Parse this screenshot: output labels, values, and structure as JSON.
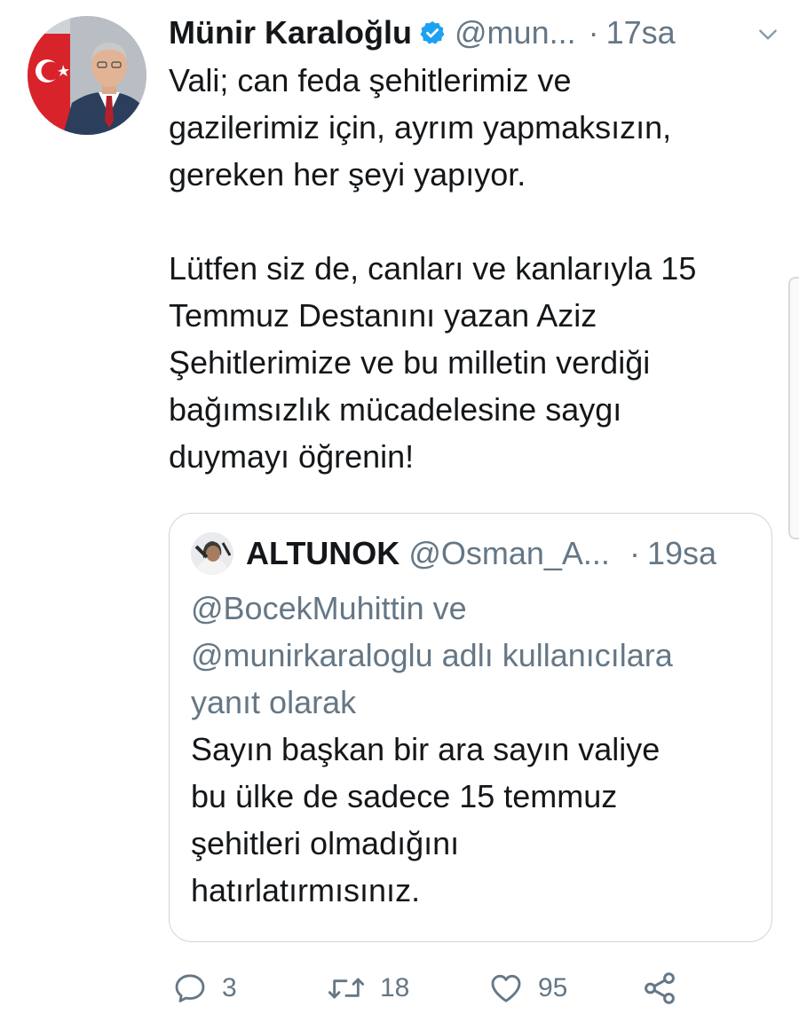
{
  "tweet": {
    "author_name": "Münir Karaloğlu",
    "handle": "@mun...",
    "separator": "·",
    "time": "17sa",
    "text": "Vali; can feda şehitlerimiz ve\ngazilerimiz için, ayrım yapmaksızın,\ngereken her şeyi yapıyor.\n\nLütfen siz de, canları ve kanlarıyla 15\nTemmuz Destanını yazan Aziz\nŞehitlerimize ve bu milletin verdiği\nbağımsızlık mücadelesine saygı\nduymayı öğrenin!"
  },
  "quoted_tweet": {
    "author_name": "ALTUNOK",
    "handle": "@Osman_A...",
    "separator": "·",
    "time": "19sa",
    "replying_to": "@BocekMuhittin ve\n@munirkaraloglu adlı kullanıcılara\nyanıt olarak",
    "text": "Sayın başkan bir ara sayın valiye\nbu ülke de sadece 15 temmuz\nşehitleri olmadığını\nhatırlatırmısınız."
  },
  "actions": {
    "replies": "3",
    "retweets": "18",
    "likes": "95"
  },
  "icons": {
    "verified": "verified-badge-icon",
    "more": "chevron-down-icon",
    "reply": "comment-icon",
    "retweet": "retweet-icon",
    "like": "heart-icon",
    "share": "share-icon"
  },
  "colors": {
    "text": "#14171a",
    "secondary": "#657786",
    "verified": "#1da1f2",
    "border": "#ccd6dd"
  }
}
